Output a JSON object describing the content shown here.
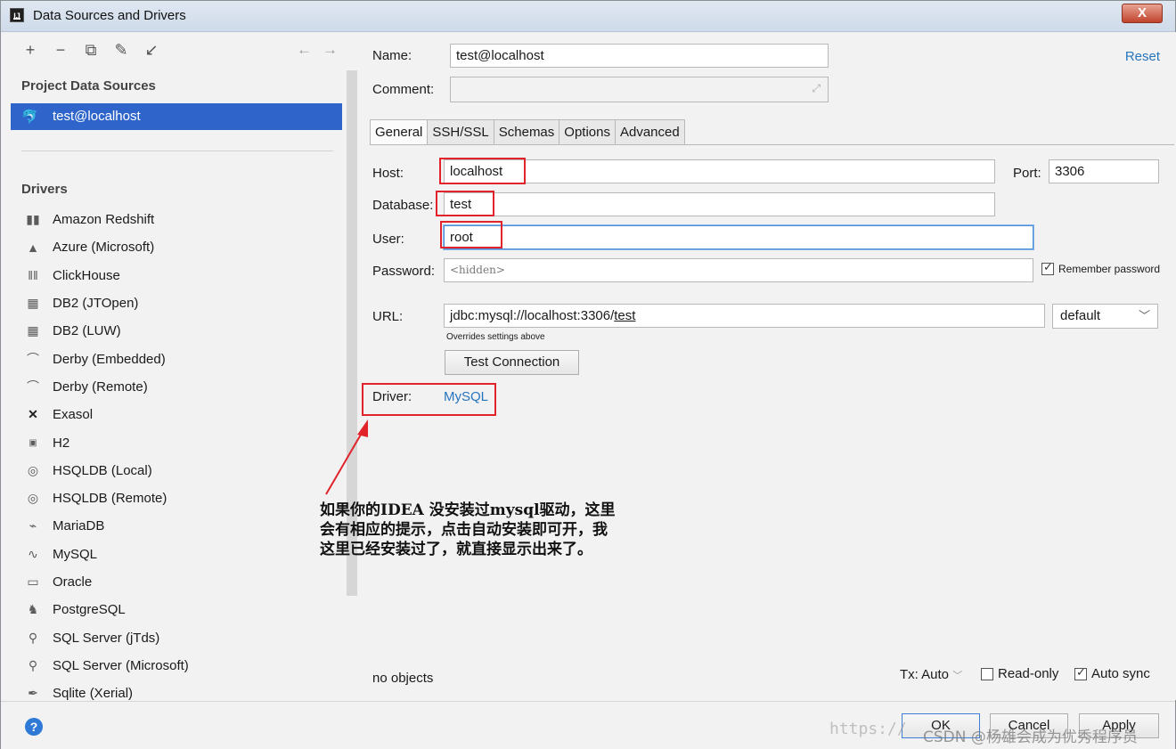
{
  "window": {
    "title": "Data Sources and Drivers",
    "close": "X"
  },
  "left": {
    "toolbar": [
      "+",
      "−",
      "⧉",
      "✎",
      "↙"
    ],
    "nav": [
      "←",
      "→"
    ],
    "project_label": "Project Data Sources",
    "datasource": "test@localhost",
    "drivers_label": "Drivers",
    "drivers": [
      {
        "name": "Amazon Redshift",
        "icon": "bars-icon"
      },
      {
        "name": "Azure (Microsoft)",
        "icon": "triangle-icon"
      },
      {
        "name": "ClickHouse",
        "icon": "columns-icon"
      },
      {
        "name": "DB2 (JTOpen)",
        "icon": "ibm-icon"
      },
      {
        "name": "DB2 (LUW)",
        "icon": "ibm-icon"
      },
      {
        "name": "Derby (Embedded)",
        "icon": "hat-icon"
      },
      {
        "name": "Derby (Remote)",
        "icon": "hat-icon"
      },
      {
        "name": "Exasol",
        "icon": "x-icon"
      },
      {
        "name": "H2",
        "icon": "h2-icon"
      },
      {
        "name": "HSQLDB (Local)",
        "icon": "q-icon"
      },
      {
        "name": "HSQLDB (Remote)",
        "icon": "q-icon"
      },
      {
        "name": "MariaDB",
        "icon": "seal-icon"
      },
      {
        "name": "MySQL",
        "icon": "dolphin-icon"
      },
      {
        "name": "Oracle",
        "icon": "oracle-icon"
      },
      {
        "name": "PostgreSQL",
        "icon": "elephant-icon"
      },
      {
        "name": "SQL Server (jTds)",
        "icon": "sqlserver-icon"
      },
      {
        "name": "SQL Server (Microsoft)",
        "icon": "sqlserver-icon"
      },
      {
        "name": "Sqlite (Xerial)",
        "icon": "feather-icon"
      }
    ]
  },
  "form": {
    "name_label": "Name:",
    "name_value": "test@localhost",
    "comment_label": "Comment:",
    "reset": "Reset",
    "tabs": [
      "General",
      "SSH/SSL",
      "Schemas",
      "Options",
      "Advanced"
    ],
    "host_label": "Host:",
    "host_value": "localhost",
    "port_label": "Port:",
    "port_value": "3306",
    "database_label": "Database:",
    "database_value": "test",
    "user_label": "User:",
    "user_value": "root",
    "password_label": "Password:",
    "password_value": "<hidden>",
    "remember_password": "Remember password",
    "url_label": "URL:",
    "url_prefix": "jdbc:mysql://localhost:3306/",
    "url_db": "test",
    "url_mode": "default",
    "overrides_note": "Overrides settings above",
    "test_connection": "Test Connection",
    "driver_label": "Driver:",
    "driver_value": "MySQL",
    "status": "no objects",
    "tx_label": "Tx: Auto",
    "readonly_label": "Read-only",
    "autosync_label": "Auto sync"
  },
  "annotation": [
    "如果你的IDEA 没安装过mysql驱动，这里",
    "会有相应的提示，点击自动安装即可开，我",
    "这里已经安装过了，就直接显示出来了。"
  ],
  "buttons": {
    "ok": "OK",
    "cancel": "Cancel",
    "apply": "Apply",
    "help": "?"
  },
  "watermark": {
    "url": "https://",
    "credit": "CSDN @杨雄会成为优秀程序员"
  },
  "colors": {
    "selection": "#2f65ca",
    "link": "#2675bf",
    "highlight_box": "#e0242a",
    "help": "#2f79d6"
  }
}
